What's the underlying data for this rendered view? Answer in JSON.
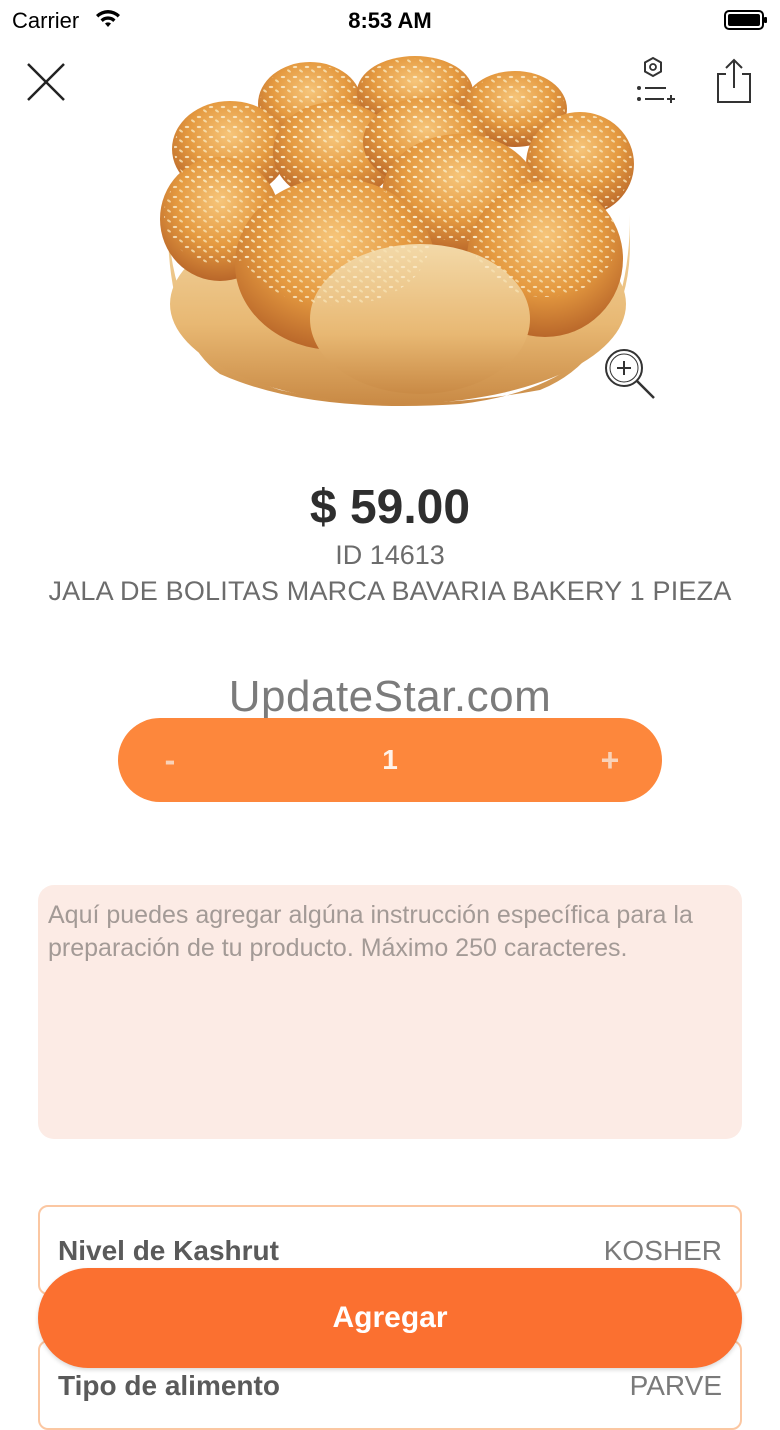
{
  "status_bar": {
    "carrier": "Carrier",
    "time": "8:53 AM"
  },
  "header": {
    "close_icon": "close-icon",
    "list_icon": "list-options-icon",
    "share_icon": "share-icon"
  },
  "product": {
    "image_icon": "bread-image",
    "price": "$ 59.00",
    "id": "ID 14613",
    "name": "JALA DE BOLITAS MARCA BAVARIA BAKERY 1 PIEZA"
  },
  "watermark": "UpdateStar.com",
  "quantity": {
    "minus": "-",
    "value": "1",
    "plus": "+"
  },
  "notes": {
    "placeholder": "Aquí puedes agregar algúna instrucción específica para la preparación de tu producto. Máximo 250 caracteres."
  },
  "attributes": [
    {
      "label": "Nivel de Kashrut",
      "value": "KOSHER"
    },
    {
      "label": "Tipo de alimento",
      "value": "PARVE"
    }
  ],
  "add_button": {
    "label": "Agregar"
  },
  "colors": {
    "accent": "#fb7030",
    "quantity_bar": "#fd873c",
    "notes_bg": "#fcebe5",
    "border": "#fbc7a2"
  }
}
